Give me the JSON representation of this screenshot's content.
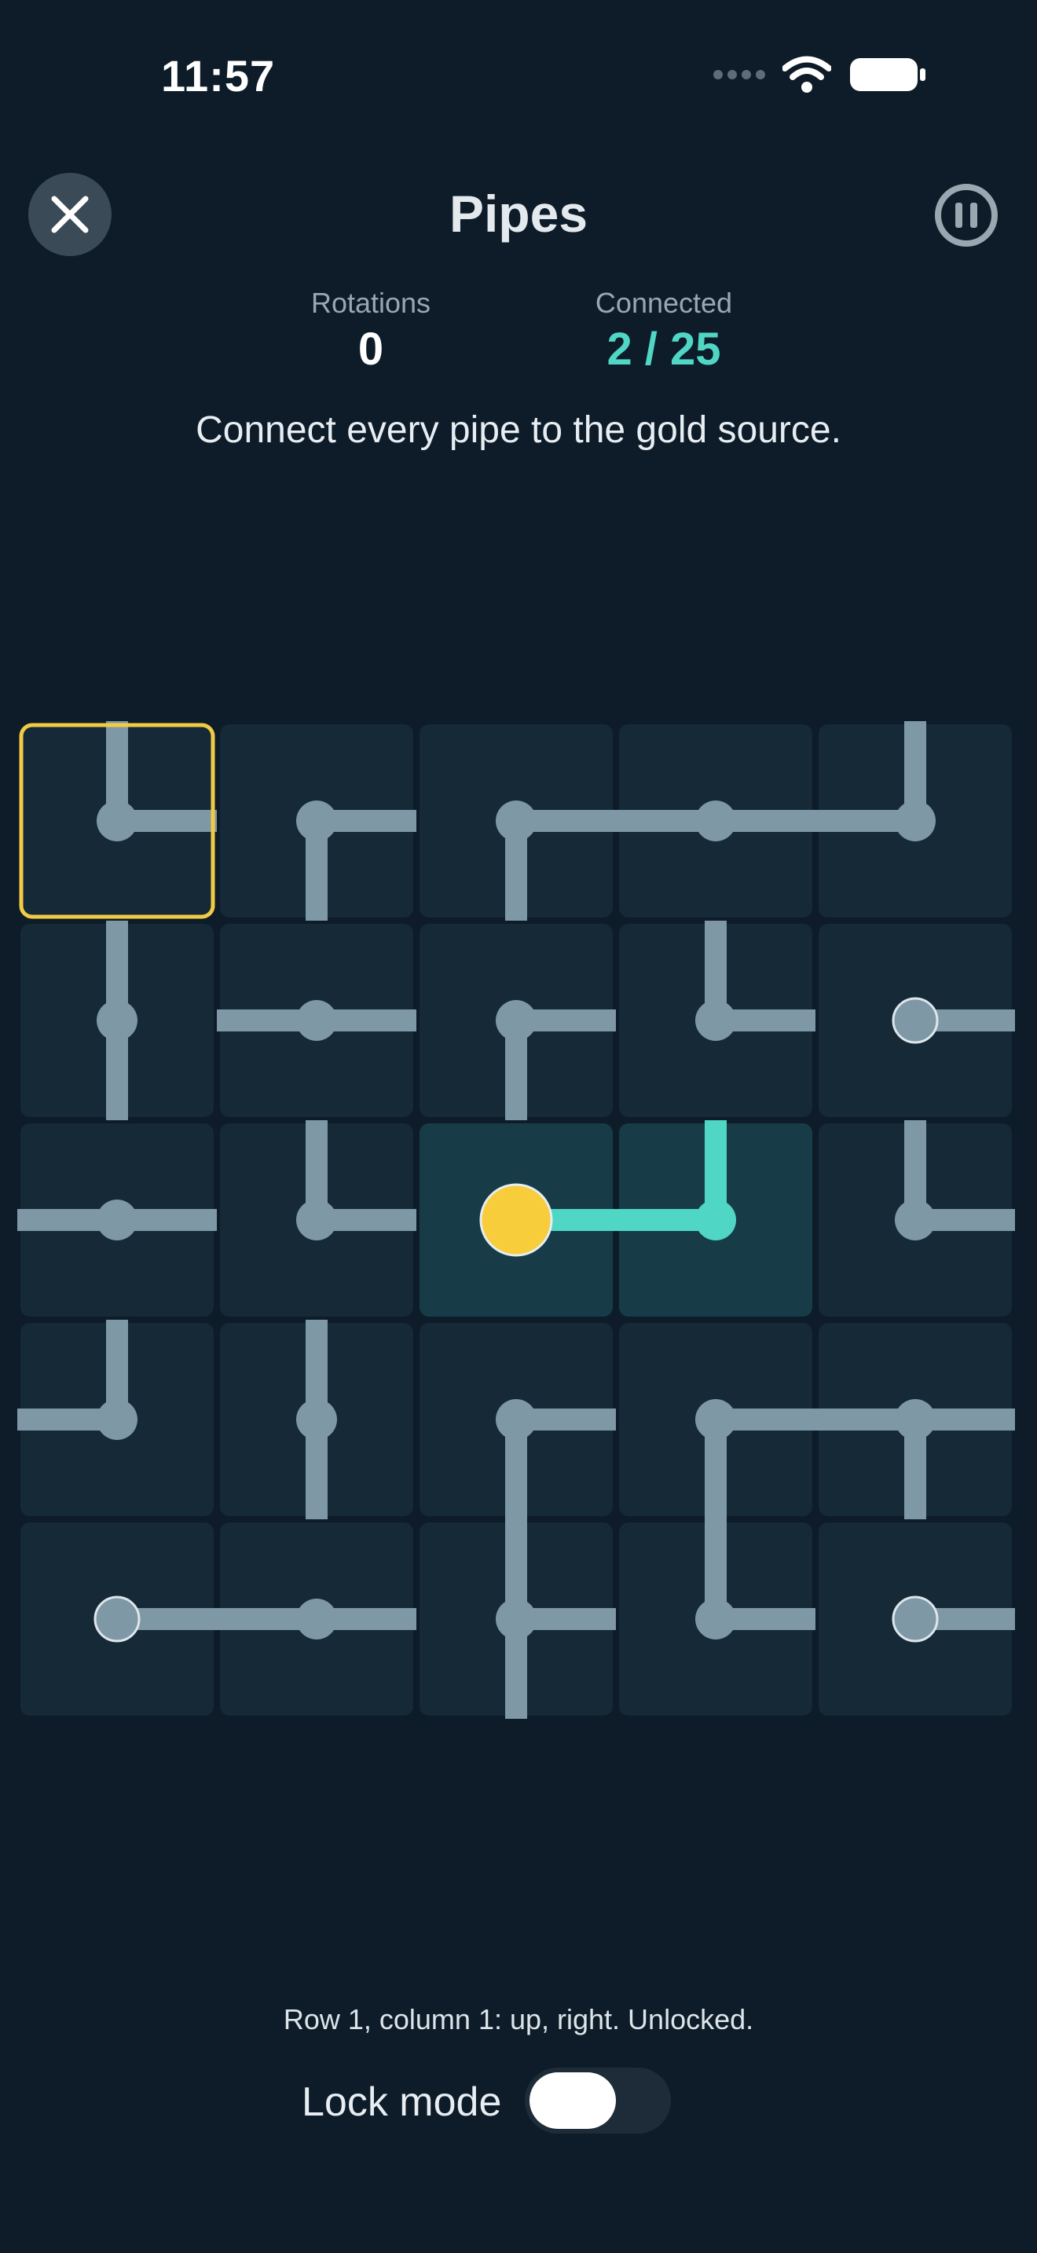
{
  "status_bar": {
    "time": "11:57"
  },
  "header": {
    "title": "Pipes",
    "close_icon": "close-icon",
    "pause_icon": "pause-icon"
  },
  "stats": {
    "rotations_label": "Rotations",
    "rotations_value": "0",
    "connected_label": "Connected",
    "connected_value": "2 / 25"
  },
  "instruction": "Connect every pipe to the gold source.",
  "board": {
    "rows": 5,
    "cols": 5,
    "selected": {
      "row": 1,
      "col": 1
    },
    "source": {
      "row": 3,
      "col": 3
    },
    "colors": {
      "tile": "#162936",
      "tile_lit": "#173c48",
      "pipe": "#7f98a6",
      "pipe_lit": "#4fd6c4",
      "source": "#f7cd3c",
      "selection": "#f2cb45"
    },
    "tiles": [
      [
        {
          "dirs": [
            "up",
            "right"
          ]
        },
        {
          "dirs": [
            "right",
            "down"
          ]
        },
        {
          "dirs": [
            "right",
            "down"
          ]
        },
        {
          "dirs": [
            "left",
            "right"
          ]
        },
        {
          "dirs": [
            "up",
            "left"
          ]
        }
      ],
      [
        {
          "dirs": [
            "up",
            "down"
          ]
        },
        {
          "dirs": [
            "left",
            "right"
          ]
        },
        {
          "dirs": [
            "right",
            "down"
          ]
        },
        {
          "dirs": [
            "up",
            "right"
          ]
        },
        {
          "dirs": [
            "right"
          ],
          "end": true
        }
      ],
      [
        {
          "dirs": [
            "left",
            "right"
          ]
        },
        {
          "dirs": [
            "up",
            "right"
          ]
        },
        {
          "dirs": [
            "right"
          ],
          "source": true,
          "lit": true
        },
        {
          "dirs": [
            "up",
            "left"
          ],
          "lit": true
        },
        {
          "dirs": [
            "up",
            "right"
          ]
        }
      ],
      [
        {
          "dirs": [
            "up",
            "left"
          ]
        },
        {
          "dirs": [
            "up",
            "down"
          ]
        },
        {
          "dirs": [
            "right",
            "down"
          ]
        },
        {
          "dirs": [
            "right",
            "down"
          ]
        },
        {
          "dirs": [
            "left",
            "right",
            "down"
          ]
        }
      ],
      [
        {
          "dirs": [
            "right"
          ],
          "end": true
        },
        {
          "dirs": [
            "left",
            "right"
          ]
        },
        {
          "dirs": [
            "up",
            "right",
            "down"
          ]
        },
        {
          "dirs": [
            "up",
            "right"
          ]
        },
        {
          "dirs": [
            "right"
          ],
          "end": true
        }
      ]
    ]
  },
  "footer": {
    "status_text": "Row 1, column 1: up, right. Unlocked.",
    "lock_label": "Lock mode",
    "lock_on": false
  }
}
